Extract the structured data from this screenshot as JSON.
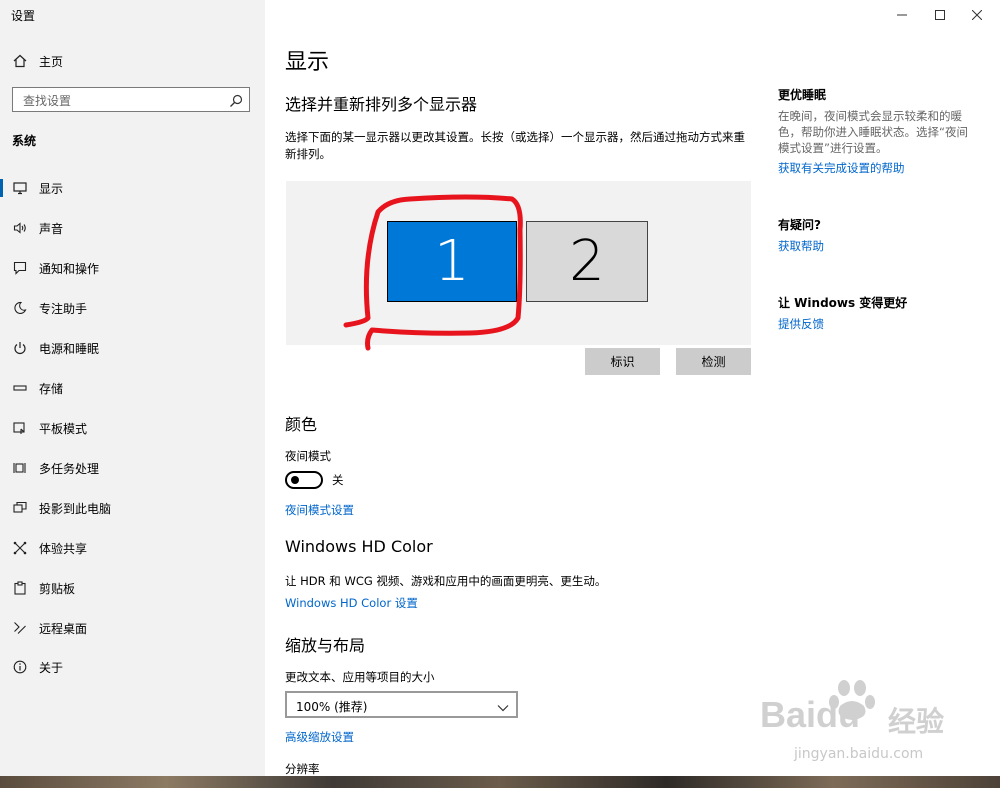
{
  "window": {
    "title": "设置"
  },
  "sidebar": {
    "home": "主页",
    "search_placeholder": "查找设置",
    "group": "系统",
    "items": [
      {
        "label": "显示",
        "icon": "monitor-icon"
      },
      {
        "label": "声音",
        "icon": "speaker-icon"
      },
      {
        "label": "通知和操作",
        "icon": "notification-icon"
      },
      {
        "label": "专注助手",
        "icon": "moon-icon"
      },
      {
        "label": "电源和睡眠",
        "icon": "power-icon"
      },
      {
        "label": "存储",
        "icon": "storage-icon"
      },
      {
        "label": "平板模式",
        "icon": "tablet-icon"
      },
      {
        "label": "多任务处理",
        "icon": "multitask-icon"
      },
      {
        "label": "投影到此电脑",
        "icon": "project-icon"
      },
      {
        "label": "体验共享",
        "icon": "share-icon"
      },
      {
        "label": "剪贴板",
        "icon": "clipboard-icon"
      },
      {
        "label": "远程桌面",
        "icon": "remote-icon"
      },
      {
        "label": "关于",
        "icon": "info-icon"
      }
    ],
    "selected": "显示"
  },
  "main": {
    "title": "显示",
    "arrange": {
      "heading": "选择并重新排列多个显示器",
      "desc": "选择下面的某一显示器以更改其设置。长按（或选择）一个显示器，然后通过拖动方式来重新排列。",
      "monitors": [
        {
          "label": "1",
          "selected": true
        },
        {
          "label": "2",
          "selected": false
        }
      ],
      "identify": "标识",
      "detect": "检测"
    },
    "color": {
      "heading": "颜色",
      "night_label": "夜间模式",
      "night_state": "关",
      "night_link": "夜间模式设置"
    },
    "hdr": {
      "heading": "Windows HD Color",
      "desc": "让 HDR 和 WCG 视频、游戏和应用中的画面更明亮、更生动。",
      "link": "Windows HD Color 设置"
    },
    "scale": {
      "heading": "缩放与布局",
      "label": "更改文本、应用等项目的大小",
      "value": "100% (推荐)",
      "link": "高级缩放设置",
      "resolution_label": "分辨率"
    }
  },
  "aside": {
    "sleep_heading": "更优睡眠",
    "sleep_text": "在晚间，夜间模式会显示较柔和的暖色，帮助你进入睡眠状态。选择“夜间模式设置”进行设置。",
    "sleep_link": "获取有关完成设置的帮助",
    "question_heading": "有疑问?",
    "question_link": "获取帮助",
    "improve_heading": "让 Windows 变得更好",
    "improve_link": "提供反馈"
  },
  "watermark": {
    "brand": "Baidu",
    "cn": "经验",
    "url": "jingyan.baidu.com"
  },
  "colors": {
    "accent": "#0078d7",
    "link": "#0066cc",
    "annotation": "#e8141d"
  }
}
